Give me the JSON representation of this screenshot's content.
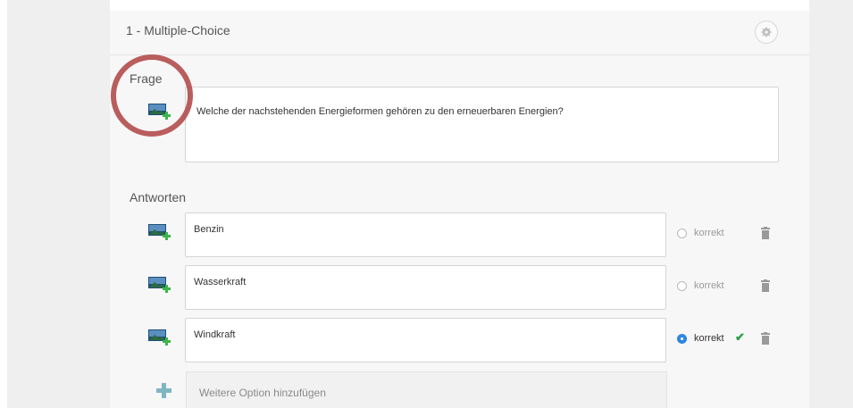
{
  "question_block": {
    "title": "1 - Multiple-Choice",
    "settings_icon": "gear-icon"
  },
  "question": {
    "label": "Frage",
    "text": "Welche der nachstehenden Energieformen gehören zu den erneuerbaren Energien?",
    "image_icon": "image-add-icon"
  },
  "answers": {
    "label": "Antworten",
    "items": [
      {
        "text": "Benzin",
        "correct_label": "korrekt",
        "is_correct": false
      },
      {
        "text": "Wasserkraft",
        "correct_label": "korrekt",
        "is_correct": false
      },
      {
        "text": "Windkraft",
        "correct_label": "korrekt",
        "is_correct": true
      }
    ],
    "add_option_label": "Weitere Option hinzufügen"
  },
  "colors": {
    "radio_selected": "#2f86de",
    "check": "#2aa14a",
    "annotation_circle": "#b14b4b",
    "plus_green": "#3cb54a",
    "plus_teal": "#7fb6c3"
  }
}
